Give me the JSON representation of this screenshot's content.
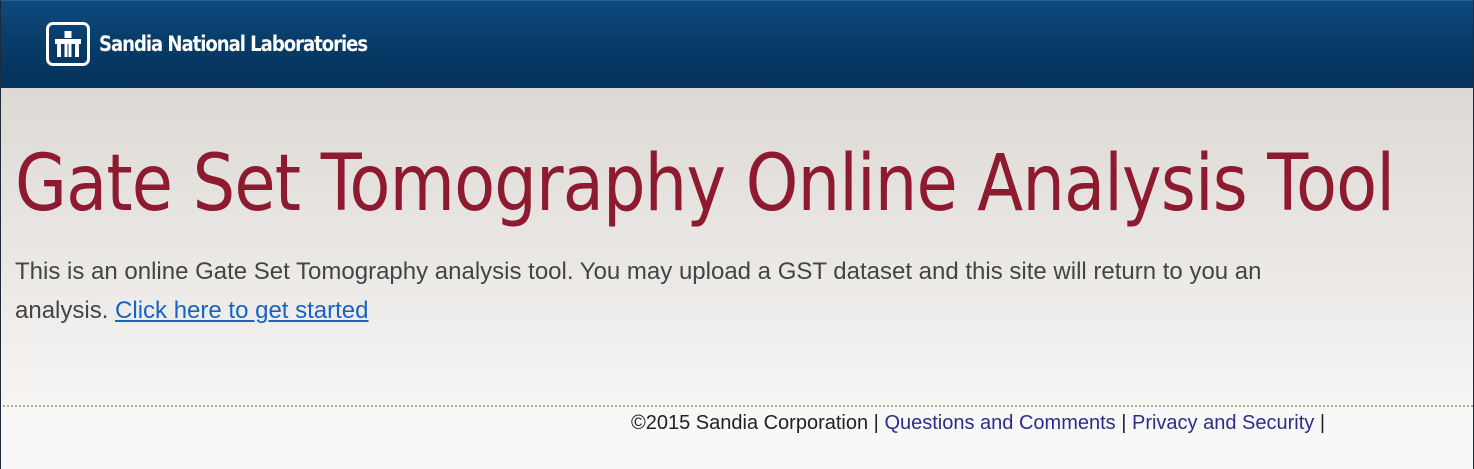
{
  "header": {
    "logo_text": "Sandia National Laboratories",
    "logo_icon": "sandia-thunderbird-icon",
    "background_color": "#073a66"
  },
  "main": {
    "title": "Gate Set Tomography Online Analysis Tool",
    "intro_text": "This is an online Gate Set Tomography analysis tool. You may upload a GST dataset and this site will return to you an analysis. ",
    "start_link": "Click here to get started",
    "title_color": "#8d1a2e",
    "link_color": "#1565c0"
  },
  "footer": {
    "copyright": "©2015 Sandia Corporation",
    "separator": " | ",
    "links": [
      {
        "label": "Questions and Comments"
      },
      {
        "label": "Privacy and Security"
      }
    ],
    "trailing_separator": " |"
  }
}
